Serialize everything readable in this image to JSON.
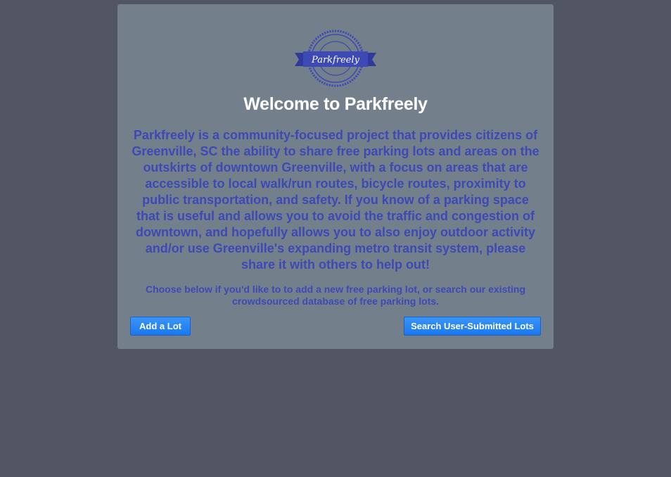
{
  "logo": {
    "text": "Parkfreely",
    "icon": "parkfreely-badge-logo",
    "color": "#3d4ab5"
  },
  "welcome": {
    "title": "Welcome to Parkfreely",
    "description": "Parkfreely is a community-focused project that provides citizens of Greenville, SC the ability to share free parking lots and areas on the outskirts of downtown Greenville, with a focus on areas that are accessible to local walk/run routes, bicycle routes, proximity to public transportation, and safety. If you know of a parking space that is useful and allows you to avoid the traffic and congestion of downtown, and hopefully allows you to also enjoy outdoor activity and/or use Greenville's expanding metro transit system, please share it with others to help out!",
    "instructions": "Choose below if you'd like to to add a new free parking lot, or search our existing crowdsourced database of free parking lots."
  },
  "actions": {
    "add_label": "Add a Lot",
    "search_label": "Search User-Submitted Lots"
  },
  "colors": {
    "background": "#525663",
    "card": "#737f8b",
    "text_accent": "#3d4ab5",
    "button": "#1a78ee"
  }
}
